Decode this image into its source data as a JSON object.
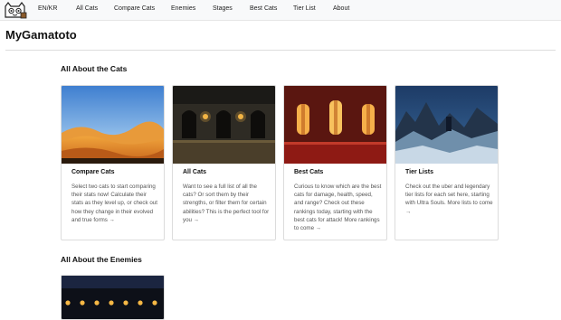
{
  "nav": {
    "logo_icon": "cat-face-logo",
    "items": [
      {
        "label": "EN/KR"
      },
      {
        "label": "All Cats"
      },
      {
        "label": "Compare Cats"
      },
      {
        "label": "Enemies"
      },
      {
        "label": "Stages"
      },
      {
        "label": "Best Cats"
      },
      {
        "label": "Tier List"
      },
      {
        "label": "About"
      }
    ]
  },
  "site_title": "MyGamatoto",
  "sections": {
    "cats_heading": "All About the Cats",
    "enemies_heading": "All About the Enemies"
  },
  "cards": [
    {
      "title": "Compare Cats",
      "text": "Select two cats to start comparing their stats now! Calculate their stats as they level up, or check out how they change in their evolved and true forms →",
      "image": "desert-dunes-background"
    },
    {
      "title": "All Cats",
      "text": "Want to see a full list of all the cats? Or sort them by their strengths, or filter them for certain abilities? This is the perfect tool for you →",
      "image": "dark-castle-arches-background"
    },
    {
      "title": "Best Cats",
      "text": "Curious to know which are the best cats for damage, health, speed, and range? Check out these rankings today, starting with the best cats for attack! More rankings to come →",
      "image": "red-palace-windows-background"
    },
    {
      "title": "Tier Lists",
      "text": "Check out the uber and legendary tier lists for each set here, starting with Ultra Souls. More lists to come →",
      "image": "stormy-ruins-background"
    }
  ],
  "enemy_cards": [
    {
      "image": "night-lanterns-background"
    }
  ],
  "colors": {
    "nav_bg": "#f8f9fa",
    "border": "#dcdcdc",
    "text_muted": "#555555"
  }
}
